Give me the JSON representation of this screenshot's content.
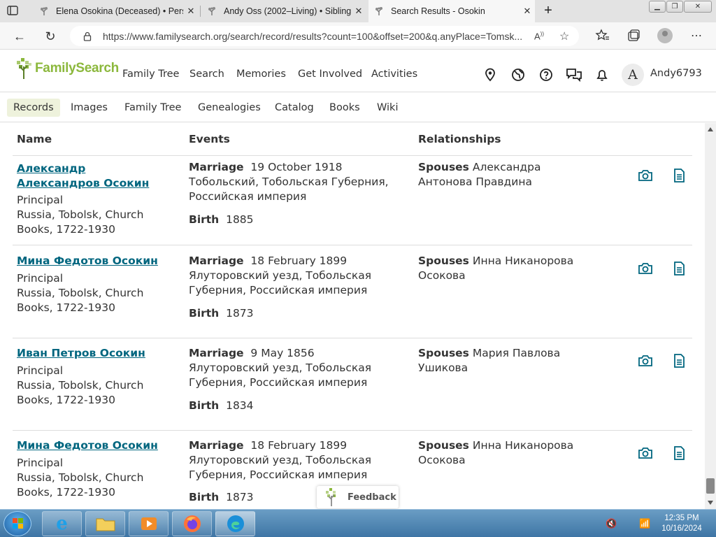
{
  "browser": {
    "tabs": [
      {
        "title": "Elena Osokina (Deceased) • Perso",
        "active": false
      },
      {
        "title": "Andy Oss (2002–Living) • Sibling",
        "active": false
      },
      {
        "title": "Search Results - Osokin",
        "active": true
      }
    ],
    "url": "https://www.familysearch.org/search/record/results?count=100&offset=200&q.anyPlace=Tomsk..."
  },
  "site": {
    "logo_text": "FamilySearch",
    "nav": [
      "Family Tree",
      "Search",
      "Memories",
      "Get Involved",
      "Activities"
    ],
    "avatar_letter": "A",
    "username": "Andy6793",
    "subnav": [
      "Records",
      "Images",
      "Family Tree",
      "Genealogies",
      "Catalog",
      "Books",
      "Wiki"
    ],
    "subnav_active": "Records",
    "brand_color": "#8cb83d",
    "link_color": "#00667f"
  },
  "results": {
    "headers": {
      "name": "Name",
      "events": "Events",
      "relationships": "Relationships"
    },
    "rows": [
      {
        "name": "Александр Александров Осокин",
        "role": "Principal",
        "collection": "Russia, Tobolsk, Church Books, 1722-1930",
        "event1_label": "Marriage",
        "event1_date": "19 October 1918",
        "event1_place": "Тобольский, Тобольская Губерния, Российская империя",
        "event2_label": "Birth",
        "event2_date": "1885",
        "rel_label": "Spouses",
        "rel_value": "Александра Антонова Правдина"
      },
      {
        "name": "Мина Федотов Осокин",
        "role": "Principal",
        "collection": "Russia, Tobolsk, Church Books, 1722-1930",
        "event1_label": "Marriage",
        "event1_date": "18 February 1899",
        "event1_place": "Ялуторовский уезд, Тобольская Губерния, Российская империя",
        "event2_label": "Birth",
        "event2_date": "1873",
        "rel_label": "Spouses",
        "rel_value": "Инна Никанорова Осокова"
      },
      {
        "name": "Иван Петров Осокин",
        "role": "Principal",
        "collection": "Russia, Tobolsk, Church Books, 1722-1930",
        "event1_label": "Marriage",
        "event1_date": "9 May 1856",
        "event1_place": "Ялуторовский уезд, Тобольская Губерния, Российская империя",
        "event2_label": "Birth",
        "event2_date": "1834",
        "rel_label": "Spouses",
        "rel_value": "Мария Павлова Ушикова"
      },
      {
        "name": "Мина Федотов Осокин",
        "role": "Principal",
        "collection": "Russia, Tobolsk, Church Books, 1722-1930",
        "event1_label": "Marriage",
        "event1_date": "18 February 1899",
        "event1_place": "Ялуторовский уезд, Тобольская Губерния, Российская империя",
        "event2_label": "Birth",
        "event2_date": "1873",
        "rel_label": "Spouses",
        "rel_value": "Инна Никанорова Осокова"
      }
    ]
  },
  "feedback_label": "Feedback",
  "taskbar": {
    "time": "12:35 PM",
    "date": "10/16/2024"
  }
}
